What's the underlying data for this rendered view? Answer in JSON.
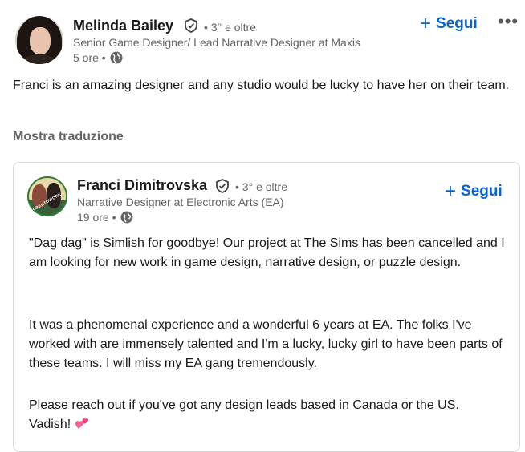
{
  "post": {
    "author": {
      "name": "Melinda Bailey",
      "degree": "• 3° e oltre",
      "headline": "Senior Game Designer/ Lead Narrative Designer at Maxis",
      "time": "5 ore •"
    },
    "follow_label": "Segui",
    "more_label": "•••",
    "text": "Franci is an amazing designer and any studio would be lucky to have her on their team.",
    "translate_label": "Mostra traduzione"
  },
  "shared": {
    "author": {
      "name": "Franci Dimitrovska",
      "degree": "• 3° e oltre",
      "headline": "Narrative Designer at Electronic Arts (EA)",
      "time": "19 ore •",
      "avatar_badge": "#OPENTOWORK"
    },
    "follow_label": "Segui",
    "paragraphs": [
      "\"Dag dag\" is Simlish for goodbye! Our project at The Sims has been cancelled and I am looking for new work in game design, narrative design, or puzzle design.",
      "It was a phenomenal experience and a wonderful 6 years at EA. The folks I've worked with are immensely talented and I'm a lucky, lucky girl to have been parts of these teams. I will miss my EA gang tremendously.",
      "Please reach out if you've got any design leads based in Canada or the US."
    ],
    "closing": "Vadish!"
  },
  "colors": {
    "accent": "#0a66c2",
    "muted": "#666666",
    "text": "#191919",
    "open_to_work": "#2e7d32"
  },
  "icons": [
    "verified-shield-icon",
    "globe-icon",
    "plus-icon",
    "more-horizontal-icon",
    "hearts-emoji-icon"
  ]
}
